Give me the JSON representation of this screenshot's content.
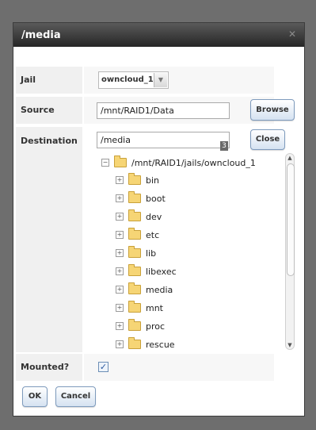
{
  "dialog": {
    "title": "/media",
    "close_glyph": "✕"
  },
  "form": {
    "jail_label": "Jail",
    "jail_value": "owncloud_1",
    "source_label": "Source",
    "source_value": "/mnt/RAID1/Data",
    "destination_label": "Destination",
    "destination_value": "/media",
    "destination_counter": "3",
    "mounted_label": "Mounted?",
    "mounted_checked": true
  },
  "buttons": {
    "browse": "Browse",
    "close": "Close",
    "ok": "OK",
    "cancel": "Cancel"
  },
  "tree": {
    "root": "/mnt/RAID1/jails/owncloud_1",
    "items": [
      "bin",
      "boot",
      "dev",
      "etc",
      "lib",
      "libexec",
      "media",
      "mnt",
      "proc",
      "rescue"
    ]
  },
  "colors": {
    "titlebar": "#262626",
    "button_border": "#7e9bbd",
    "folder": "#f6d575"
  }
}
